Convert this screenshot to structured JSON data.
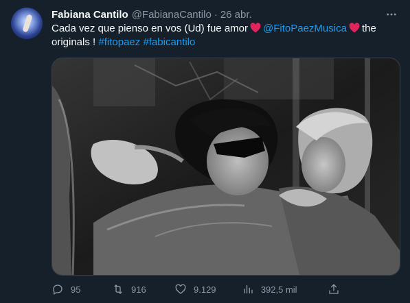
{
  "tweet": {
    "author_name": "Fabiana Cantilo",
    "author_handle": "@FabianaCantilo",
    "separator": "·",
    "date": "26 abr.",
    "text": {
      "part1": "Cada vez que pienso en vos (Ud) fue amor",
      "mention": "@FitoPaezMusica",
      "part2": "the originals !",
      "hashtag1": "#fitopaez",
      "hashtag2": "#fabicantilo"
    }
  },
  "metrics": {
    "replies": "95",
    "retweets": "916",
    "likes": "9.129",
    "views": "392,5 mil"
  },
  "icons": {
    "more": "more-icon",
    "heart_emoji": "heart-emoji-icon",
    "reply": "reply-icon",
    "retweet": "retweet-icon",
    "like": "like-icon",
    "views": "views-icon",
    "share": "share-icon"
  },
  "colors": {
    "background": "#15202b",
    "link": "#1d9bf0",
    "muted": "#8b98a5",
    "heart": "#e0245e"
  }
}
